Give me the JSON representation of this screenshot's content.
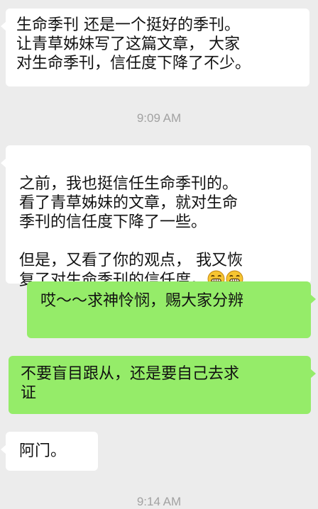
{
  "messages": [
    {
      "side": "in",
      "text": "生命季刊  还是一个挺好的季刊。\n让青草姊妹写了这篇文章，  大家\n对生命季刊，信任度下降了不少。"
    },
    {
      "side": "in",
      "text": "之前，我也挺信任生命季刊的。\n看了青草姊妹的文章，就对生命\n季刊的信任度下降了一些。\n\n但是，又看了你的观点，  我又恢\n复了对生命季刊的信任度。",
      "emoji": [
        "grinning-face",
        "grinning-face"
      ]
    },
    {
      "side": "out",
      "text": "哎～～求神怜悯，赐大家分辨"
    },
    {
      "side": "out",
      "text": "不要盲目跟从，还是要自己去求\n证"
    },
    {
      "side": "in",
      "text": "阿门。"
    }
  ],
  "timestamps": [
    "9:09 AM",
    "9:14 AM"
  ],
  "colors": {
    "background": "#ececec",
    "incoming": "#ffffff",
    "outgoing": "#95ec69",
    "timestamp": "#a2a2a2"
  }
}
